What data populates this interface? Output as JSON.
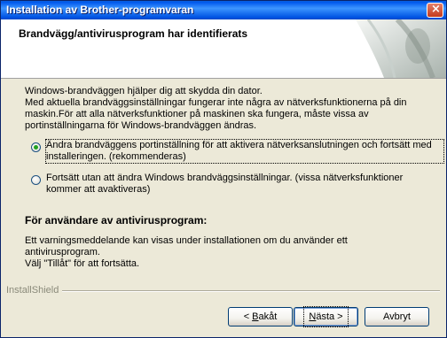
{
  "window": {
    "title": "Installation av Brother-programvaran"
  },
  "header": {
    "title": "Brandvägg/antivirusprogram har identifierats"
  },
  "intro": {
    "line1": "Windows-brandväggen hjälper dig att skydda din dator.",
    "line2": "Med aktuella brandväggsinställningar fungerar inte några av nätverksfunktionerna på din",
    "line3": "maskin.För att alla nätverksfunktioner på maskinen ska fungera, måste vissa av",
    "line4": "portinställningarna för Windows-brandväggen ändras."
  },
  "options": [
    {
      "line1": "Ändra brandväggens portinställning för att aktivera nätverksanslutningen och fortsätt med",
      "line2": "installeringen. (rekommenderas)",
      "selected": true
    },
    {
      "line1": "Fortsätt utan att ändra Windows brandväggsinställningar. (vissa nätverksfunktioner",
      "line2": "kommer att avaktiveras)",
      "selected": false
    }
  ],
  "antivirus": {
    "title": "För användare av antivirusprogram:",
    "line1": "Ett varningsmeddelande kan visas under installationen om du använder ett antivirusprogram.",
    "line2": "Välj \"Tillåt\" för att fortsätta."
  },
  "footer": {
    "brand": "InstallShield",
    "back_prefix": "< ",
    "back_mnemonic": "B",
    "back_rest": "akåt",
    "next_mnemonic": "N",
    "next_rest": "ästa >",
    "cancel_label": "Avbryt"
  },
  "icons": {
    "close": "close-icon",
    "header_art": "wizard-graphic"
  },
  "colors": {
    "titlebar": "#0054e3",
    "dialog_bg": "#ece9d8",
    "radio_dot": "#21a121"
  }
}
